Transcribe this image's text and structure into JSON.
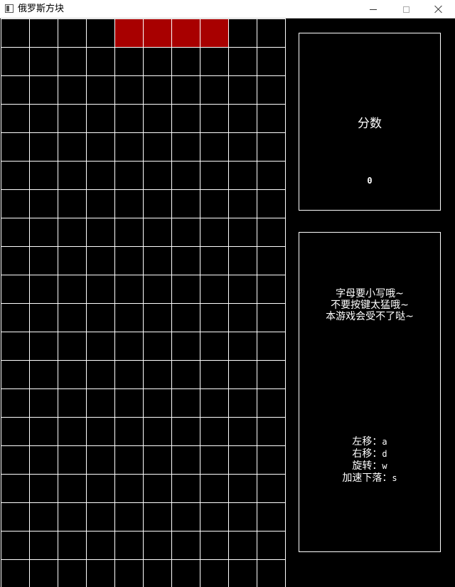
{
  "window": {
    "title": "俄罗斯方块",
    "app_icon": "window-app-icon",
    "buttons": {
      "minimize": "minimize-icon",
      "maximize": "maximize-icon",
      "close": "close-icon"
    }
  },
  "board": {
    "columns": 10,
    "rows": 20,
    "background_color": "#000000",
    "grid_color": "#ffffff",
    "active_piece": {
      "shape": "I",
      "color": "#a80000",
      "cells": [
        [
          4,
          0
        ],
        [
          5,
          0
        ],
        [
          6,
          0
        ],
        [
          7,
          0
        ]
      ]
    }
  },
  "score_panel": {
    "label": "分数",
    "value": "0"
  },
  "info_panel": {
    "tips": [
      "字母要小写哦~",
      "不要按键太猛哦~",
      "本游戏会受不了哒~"
    ],
    "controls": [
      {
        "action": "左移：",
        "key": "a"
      },
      {
        "action": "右移：",
        "key": "d"
      },
      {
        "action": "旋转：",
        "key": "w"
      },
      {
        "action": "加速下落：",
        "key": "s"
      }
    ]
  }
}
